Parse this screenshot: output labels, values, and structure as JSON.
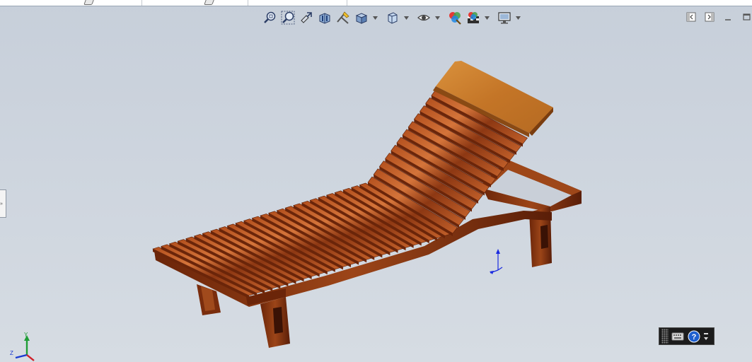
{
  "window": {
    "document_tabs": [
      {
        "name": "tab-1"
      },
      {
        "name": "tab-2"
      },
      {
        "name": "tab-3"
      }
    ]
  },
  "heads_up_toolbar": {
    "icons": [
      "zoom-to-fit-icon",
      "zoom-to-area-icon",
      "previous-view-icon",
      "section-view-icon",
      "dynamic-annotation-views-icon",
      "view-orientation-icon",
      "display-style-icon",
      "hide-show-items-icon",
      "edit-appearance-icon",
      "apply-scene-icon",
      "view-settings-icon"
    ]
  },
  "window_controls": [
    "tile-left-icon",
    "tile-right-icon",
    "minimize-icon",
    "restore-icon"
  ],
  "model": {
    "name": "wooden-chaise-lounge",
    "colors": {
      "wood_dark": "#5a1e08",
      "wood_mid": "#8a3712",
      "wood_light": "#c05a22",
      "headrest": "#c97d2c"
    }
  },
  "triad": {
    "x_label": "X",
    "y_label": "Y",
    "z_label": "Z"
  },
  "mini_toolbar": [
    "keyboard-icon",
    "help-icon"
  ]
}
